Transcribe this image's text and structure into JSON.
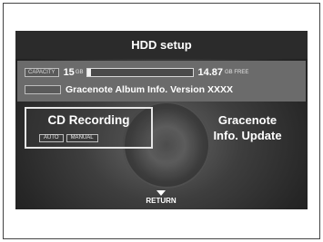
{
  "screen": {
    "title": "HDD setup",
    "capacity": {
      "tag": "CAPACITY",
      "used_value": "15",
      "used_unit": "GB",
      "fill_fraction": 0.03,
      "free_value": "14.87",
      "free_unit": "GB FREE"
    },
    "version": {
      "tag": "",
      "text": "Gracenote Album Info. Version XXXX"
    },
    "cd_recording": {
      "label": "CD Recording",
      "modes": [
        "AUTO",
        "MANUAL"
      ]
    },
    "gracenote_update": {
      "line1": "Gracenote",
      "line2": "Info. Update"
    },
    "return_label": "RETURN"
  },
  "colors": {
    "screen_bg": "#2b2b2b",
    "info_panel": "#6b6b6b",
    "text": "#ffffff"
  }
}
